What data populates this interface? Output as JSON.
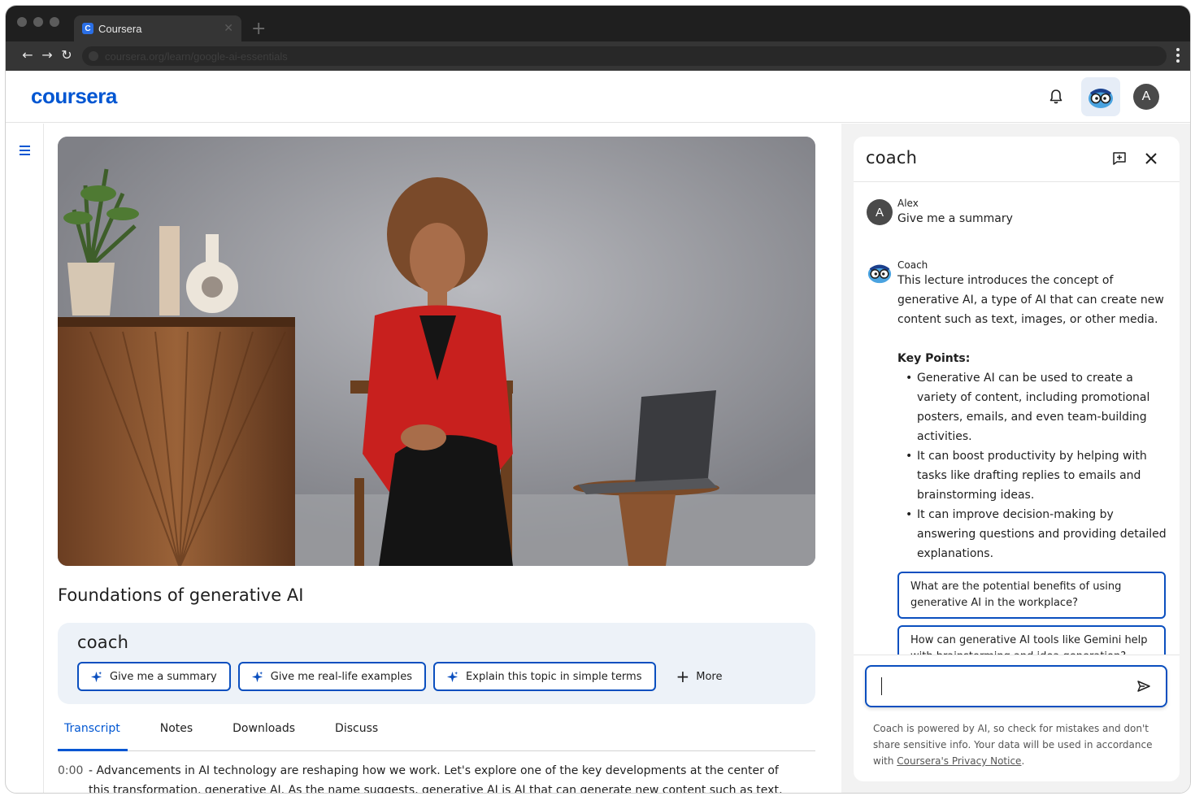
{
  "browser": {
    "tab_title": "Coursera",
    "tab_favicon_letter": "C",
    "url": "coursera.org/learn/google-ai-essentials"
  },
  "header": {
    "logo": "coursera",
    "user_initial": "A"
  },
  "lecture": {
    "title": "Foundations of generative AI"
  },
  "coach_bar": {
    "label": "coach",
    "chips": [
      "Give me a summary",
      "Give me real-life examples",
      "Explain this topic in simple terms"
    ],
    "more_label": "More"
  },
  "tabs": [
    "Transcript",
    "Notes",
    "Downloads",
    "Discuss"
  ],
  "transcript": {
    "time": "0:00",
    "text": "- Advancements in AI technology are reshaping how we work. Let's explore one of the key developments at the center of this transformation, generative AI. As the name suggests, generative AI is AI that can generate new content such as text, images, or"
  },
  "panel": {
    "title": "coach",
    "user_message": {
      "initial": "A",
      "name": "Alex",
      "text": "Give me a summary"
    },
    "coach_message": {
      "name": "Coach",
      "intro": "This lecture introduces the concept of generative AI, a type of AI that can create new content such as text, images, or other media.",
      "key_points_label": "Key Points:",
      "bullets": [
        "Generative AI can be used to create a variety of content, including promotional posters, emails, and even team-building activities.",
        "It can boost productivity by helping with tasks like drafting replies to emails and brainstorming ideas.",
        "It can improve decision-making by answering questions and providing detailed explanations."
      ]
    },
    "suggestions": [
      "What are the potential benefits of using generative AI in the workplace?",
      "How can generative AI tools like Gemini help with brainstorming and idea generation?"
    ],
    "input_value": "",
    "disclaimer_text": "Coach is powered by AI, so check for mistakes and don't share sensitive info. Your data will be used in accordance with ",
    "disclaimer_link": "Coursera's Privacy Notice",
    "disclaimer_end": "."
  },
  "colors": {
    "brand": "#0056d2",
    "chip_border": "#0b4fbf",
    "coach_bar_bg": "#edf2f8"
  },
  "icons": {
    "bell": "bell-icon",
    "coach": "coach-mascot-icon",
    "spark": "sparkle-icon",
    "new_chat": "new-chat-icon",
    "close": "close-icon",
    "send": "send-icon",
    "menu": "hamburger-icon"
  }
}
